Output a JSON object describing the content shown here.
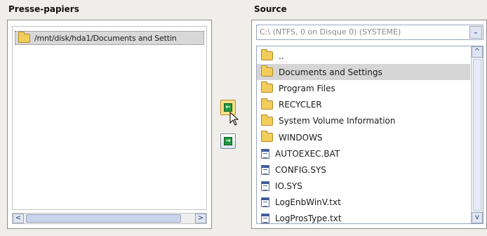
{
  "clipboard": {
    "title": "Presse-papiers",
    "item": "/mnt/disk/hda1/Documents and Settin",
    "scroll_left": "<",
    "scroll_right": ">"
  },
  "source": {
    "title": "Source",
    "drive": "C:\\  (NTFS, 0 on Disque 0) (SYSTEME)",
    "dropdown_arrow": "⌄",
    "scroll_up": "^",
    "scroll_down": "v",
    "items": [
      {
        "type": "folder",
        "name": ".."
      },
      {
        "type": "folder",
        "name": "Documents and Settings",
        "selected": true
      },
      {
        "type": "folder",
        "name": "Program Files"
      },
      {
        "type": "folder",
        "name": "RECYCLER"
      },
      {
        "type": "folder",
        "name": "System Volume Information"
      },
      {
        "type": "folder",
        "name": "WINDOWS"
      },
      {
        "type": "file",
        "name": "AUTOEXEC.BAT"
      },
      {
        "type": "file",
        "name": "CONFIG.SYS"
      },
      {
        "type": "file",
        "name": "IO.SYS"
      },
      {
        "type": "file",
        "name": "LogEnbWinV.txt"
      },
      {
        "type": "file",
        "name": "LogProsType.txt"
      }
    ]
  },
  "transfer": {
    "to_clipboard_icon": "arrow-left-icon",
    "to_clipboard_glyph": "←",
    "to_source_icon": "arrow-right-icon",
    "to_source_glyph": "→"
  },
  "colors": {
    "selection": "#d6d6d6",
    "folder": "#f2cd5a",
    "arrow_green": "#1f9a3c"
  }
}
